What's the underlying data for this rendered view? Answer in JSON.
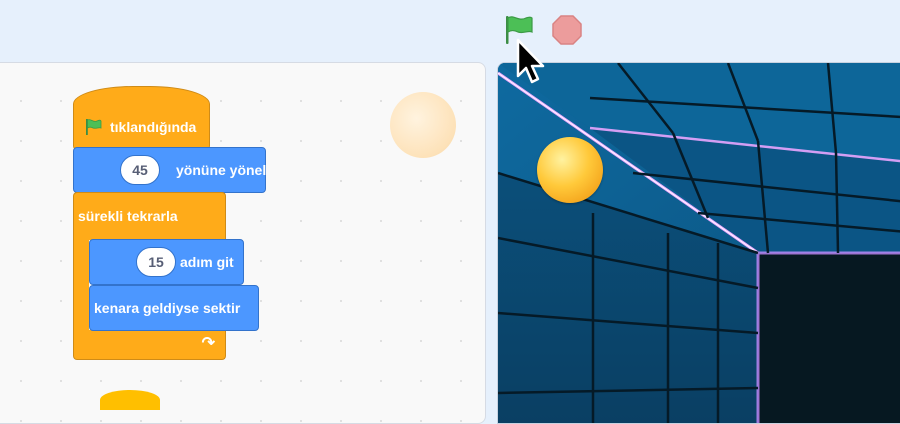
{
  "toolbar": {
    "green_flag_icon": "green-flag-icon",
    "stop_icon": "stop-icon",
    "flag_color": "#4cbf56",
    "stop_color": "#ec9c9c"
  },
  "blocks": {
    "hat": {
      "label": "tıklandığında",
      "color": "#ffab19"
    },
    "point_direction": {
      "value": "45",
      "label": "yönüne yönel"
    },
    "forever": {
      "label": "sürekli tekrarla"
    },
    "move": {
      "value": "15",
      "label": "adım git"
    },
    "bounce": {
      "label": "kenara geldiyse sektir"
    },
    "motion_color": "#4c97ff"
  },
  "stage": {
    "sprite": "ball-sprite",
    "background": "neon-grid-room"
  }
}
